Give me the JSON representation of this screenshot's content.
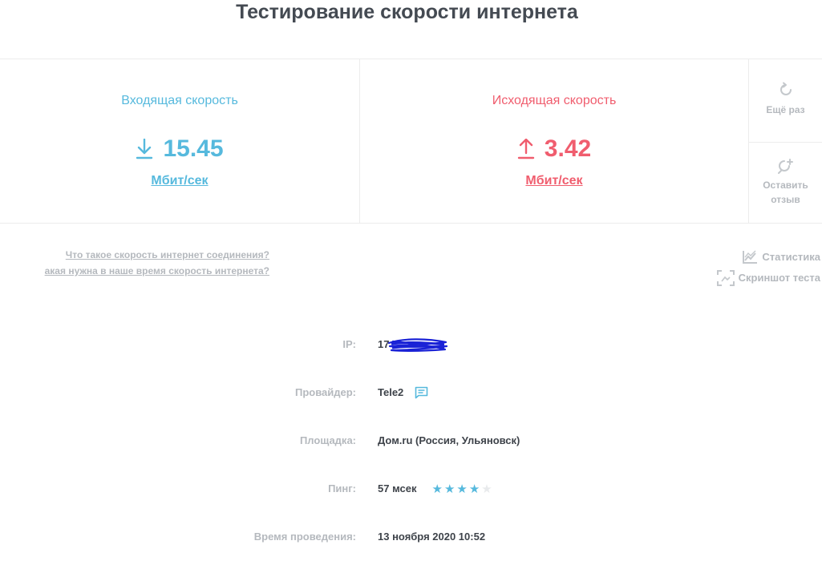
{
  "header": {
    "title": "Тестирование скорости интернета"
  },
  "results": {
    "download": {
      "label": "Входящая скорость",
      "value": "15.45",
      "unit": "Мбит/сек",
      "icon": "download-icon"
    },
    "upload": {
      "label": "Исходящая скорость",
      "value": "3.42",
      "unit": "Мбит/сек",
      "icon": "upload-icon"
    }
  },
  "actions": {
    "retry_label": "Ещё раз",
    "review_label_line1": "Оставить",
    "review_label_line2": "отзыв"
  },
  "links": {
    "what_is_speed": "Что такое скорость интернет соединения?",
    "which_needed": "акая нужна в наше время скорость интернета?"
  },
  "tools": {
    "stats_label": "Статистика",
    "screenshot_label": "Скриншот теста"
  },
  "info": {
    "ip_label": "IP:",
    "ip_value": "17",
    "provider_label": "Провайдер:",
    "provider_value": "Tele2",
    "site_label": "Площадка:",
    "site_value": "Дом.ru (Россия, Ульяновск)",
    "ping_label": "Пинг:",
    "ping_value": "57 мсек",
    "ping_rating": 4,
    "ping_rating_max": 5,
    "time_label": "Время проведения:",
    "time_value": "13 ноября 2020 10:52"
  },
  "colors": {
    "download": "#56b9dd",
    "upload": "#f05d6e",
    "muted": "#b5b9be",
    "text": "#3e434a",
    "redaction": "#1a22d6"
  }
}
